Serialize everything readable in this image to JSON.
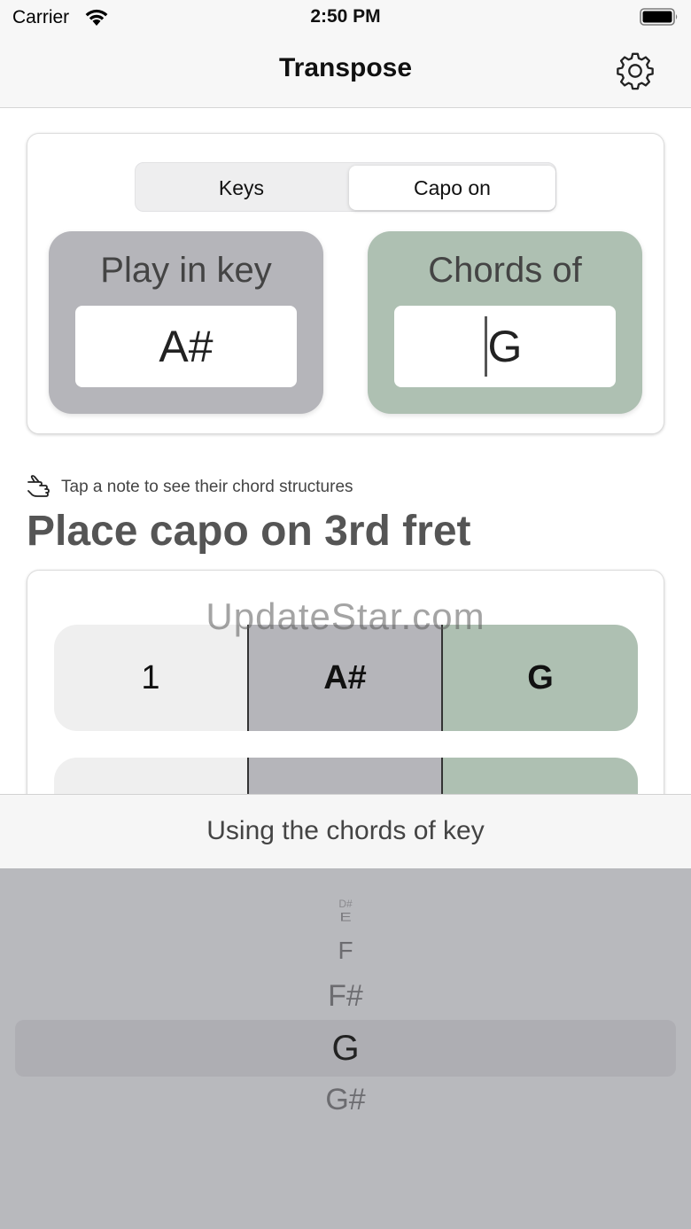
{
  "status_bar": {
    "carrier": "Carrier",
    "time": "2:50 PM"
  },
  "nav": {
    "title": "Transpose",
    "settings_icon": "gear-icon"
  },
  "segmented": {
    "options": [
      "Keys",
      "Capo on"
    ],
    "selected": "Capo on"
  },
  "play_in_key": {
    "label": "Play in key",
    "value": "A#"
  },
  "chords_of": {
    "label": "Chords of",
    "value": "G"
  },
  "hint": {
    "icon": "hand-pointer-icon",
    "text": "Tap a note to see their chord structures"
  },
  "capo_heading": "Place capo on 3rd fret",
  "rows": [
    {
      "number": "1",
      "play_key": "A#",
      "chord_key": "G"
    },
    {
      "number": "",
      "play_key": "",
      "chord_key": ""
    }
  ],
  "watermark": "UpdateStar.com",
  "picker": {
    "title": "Using the chords of key",
    "options": [
      "D#",
      "E",
      "F",
      "F#",
      "G",
      "G#"
    ],
    "selected": "G"
  },
  "colors": {
    "play_key_bg": "#b5b5ba",
    "chord_key_bg": "#aec0b2",
    "picker_bg": "#b8b9bd"
  }
}
